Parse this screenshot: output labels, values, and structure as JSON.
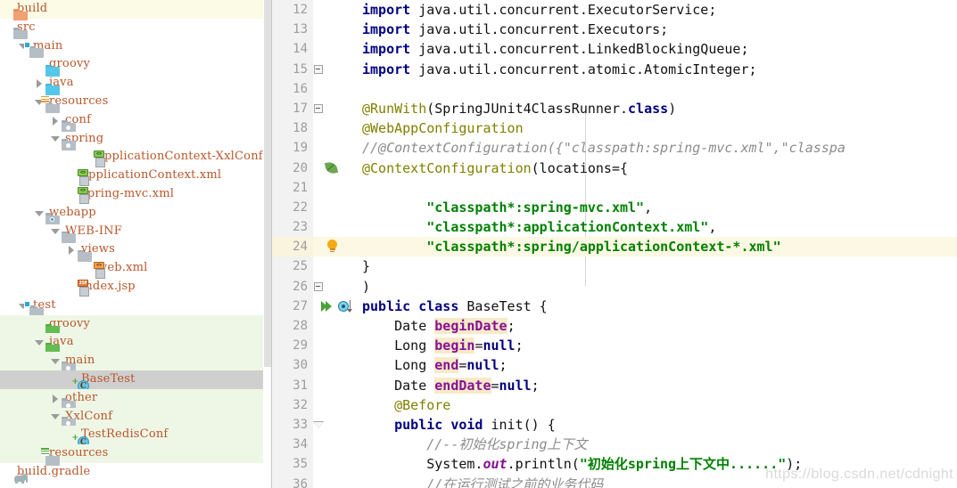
{
  "project_tree": {
    "scrollbar": {
      "name": "vertical-scrollbar"
    },
    "items": [
      {
        "label": "build",
        "indent": 0,
        "arrow": "none",
        "icon": "folder-orange",
        "state": "highlight-build"
      },
      {
        "label": "src",
        "indent": 0,
        "arrow": "none",
        "icon": "folder-gray",
        "state": "normal"
      },
      {
        "label": "main",
        "indent": 1,
        "arrow": "down",
        "icon": "folder-module",
        "state": "normal"
      },
      {
        "label": "groovy",
        "indent": 2,
        "arrow": "none",
        "icon": "folder-cyan",
        "state": "normal"
      },
      {
        "label": "java",
        "indent": 2,
        "arrow": "right",
        "icon": "folder-cyan",
        "state": "normal"
      },
      {
        "label": "resources",
        "indent": 2,
        "arrow": "down",
        "icon": "folder-resources",
        "state": "normal"
      },
      {
        "label": "conf",
        "indent": 3,
        "arrow": "right",
        "icon": "folder-package",
        "state": "normal"
      },
      {
        "label": "spring",
        "indent": 3,
        "arrow": "down",
        "icon": "folder-package",
        "state": "normal"
      },
      {
        "label": "applicationContext-XxlConf.:",
        "indent": 5,
        "arrow": "none",
        "icon": "file-xml-green",
        "state": "normal"
      },
      {
        "label": "applicationContext.xml",
        "indent": 4,
        "arrow": "none",
        "icon": "file-xml-green",
        "state": "normal"
      },
      {
        "label": "spring-mvc.xml",
        "indent": 4,
        "arrow": "none",
        "icon": "file-xml-green",
        "state": "normal"
      },
      {
        "label": "webapp",
        "indent": 2,
        "arrow": "down",
        "icon": "folder-webapp",
        "state": "normal"
      },
      {
        "label": "WEB-INF",
        "indent": 3,
        "arrow": "down",
        "icon": "folder-gray",
        "state": "normal"
      },
      {
        "label": "views",
        "indent": 4,
        "arrow": "right",
        "icon": "folder-gray",
        "state": "normal"
      },
      {
        "label": "web.xml",
        "indent": 5,
        "arrow": "none",
        "icon": "file-xml-orange",
        "state": "normal"
      },
      {
        "label": "index.jsp",
        "indent": 4,
        "arrow": "none",
        "icon": "file-jsp",
        "state": "normal"
      },
      {
        "label": "test",
        "indent": 1,
        "arrow": "down",
        "icon": "folder-module",
        "state": "normal"
      },
      {
        "label": "groovy",
        "indent": 2,
        "arrow": "none",
        "icon": "folder-green",
        "state": "highlight-green"
      },
      {
        "label": "java",
        "indent": 2,
        "arrow": "down",
        "icon": "folder-green",
        "state": "highlight-green"
      },
      {
        "label": "main",
        "indent": 3,
        "arrow": "down",
        "icon": "folder-package",
        "state": "highlight-green"
      },
      {
        "label": "BaseTest",
        "indent": 4,
        "arrow": "none",
        "icon": "file-class",
        "state": "selected"
      },
      {
        "label": "other",
        "indent": 3,
        "arrow": "right",
        "icon": "folder-package",
        "state": "highlight-green"
      },
      {
        "label": "XxlConf",
        "indent": 3,
        "arrow": "down",
        "icon": "folder-package",
        "state": "highlight-green"
      },
      {
        "label": "TestRedisConf",
        "indent": 4,
        "arrow": "none",
        "icon": "file-class",
        "state": "highlight-green"
      },
      {
        "label": "resources",
        "indent": 2,
        "arrow": "none",
        "icon": "folder-test-resources",
        "state": "highlight-green"
      },
      {
        "label": "build.gradle",
        "indent": 0,
        "arrow": "none",
        "icon": "file-gradle",
        "state": "normal"
      }
    ]
  },
  "editor": {
    "lines": [
      {
        "num": "12",
        "mark": "none",
        "fold": "none",
        "tokens": [
          {
            "t": "import ",
            "c": "kw"
          },
          {
            "t": "java.util.concurrent.ExecutorService;",
            "c": "plain"
          }
        ]
      },
      {
        "num": "13",
        "mark": "none",
        "fold": "none",
        "tokens": [
          {
            "t": "import ",
            "c": "kw"
          },
          {
            "t": "java.util.concurrent.Executors;",
            "c": "plain"
          }
        ]
      },
      {
        "num": "14",
        "mark": "none",
        "fold": "none",
        "tokens": [
          {
            "t": "import ",
            "c": "kw"
          },
          {
            "t": "java.util.concurrent.LinkedBlockingQueue;",
            "c": "plain"
          }
        ]
      },
      {
        "num": "15",
        "mark": "none",
        "fold": "box",
        "tokens": [
          {
            "t": "import ",
            "c": "kw"
          },
          {
            "t": "java.util.concurrent.atomic.AtomicInteger;",
            "c": "plain"
          }
        ]
      },
      {
        "num": "16",
        "mark": "none",
        "fold": "none",
        "tokens": []
      },
      {
        "num": "17",
        "mark": "none",
        "fold": "box",
        "tokens": [
          {
            "t": "@RunWith",
            "c": "ann"
          },
          {
            "t": "(SpringJUnit4ClassRunner.",
            "c": "plain"
          },
          {
            "t": "class",
            "c": "kw"
          },
          {
            "t": ")",
            "c": "plain"
          }
        ]
      },
      {
        "num": "18",
        "mark": "none",
        "fold": "rail",
        "tokens": [
          {
            "t": "@WebAppConfiguration",
            "c": "ann"
          }
        ]
      },
      {
        "num": "19",
        "mark": "none",
        "fold": "rail",
        "tokens": [
          {
            "t": "//@ContextConfiguration({\"classpath:spring-mvc.xml\",\"classpa",
            "c": "cmt"
          }
        ]
      },
      {
        "num": "20",
        "mark": "leaf",
        "fold": "rail",
        "tokens": [
          {
            "t": "@ContextConfiguration",
            "c": "ann"
          },
          {
            "t": "(locations={",
            "c": "plain"
          }
        ]
      },
      {
        "num": "21",
        "mark": "none",
        "fold": "rail",
        "tokens": []
      },
      {
        "num": "22",
        "mark": "none",
        "fold": "rail",
        "tokens": [
          {
            "t": "        \"classpath*:spring-mvc.xml\"",
            "c": "str"
          },
          {
            "t": ",",
            "c": "plain"
          }
        ]
      },
      {
        "num": "23",
        "mark": "none",
        "fold": "rail",
        "tokens": [
          {
            "t": "        \"classpath*:applicationContext.xml\"",
            "c": "str"
          },
          {
            "t": ",",
            "c": "plain"
          }
        ]
      },
      {
        "num": "24",
        "mark": "bulb",
        "fold": "rail",
        "highlight": true,
        "tokens": [
          {
            "t": "        \"classpath*:spring/applicationContext-*.xml\"",
            "c": "str"
          }
        ]
      },
      {
        "num": "25",
        "mark": "none",
        "fold": "rail",
        "tokens": [
          {
            "t": "}",
            "c": "plain"
          }
        ]
      },
      {
        "num": "26",
        "mark": "none",
        "fold": "end",
        "tokens": [
          {
            "t": ")",
            "c": "plain"
          }
        ]
      },
      {
        "num": "27",
        "mark": "run-override",
        "fold": "none",
        "tokens": [
          {
            "t": "public class ",
            "c": "kw"
          },
          {
            "t": "BaseTest {",
            "c": "plain"
          }
        ]
      },
      {
        "num": "28",
        "mark": "none",
        "fold": "none",
        "tokens": [
          {
            "t": "    Date ",
            "c": "plain"
          },
          {
            "t": "beginDate",
            "c": "fld"
          },
          {
            "t": ";",
            "c": "plain"
          }
        ]
      },
      {
        "num": "29",
        "mark": "none",
        "fold": "none",
        "tokens": [
          {
            "t": "    Long ",
            "c": "plain"
          },
          {
            "t": "begin",
            "c": "fld"
          },
          {
            "t": "=",
            "c": "plain"
          },
          {
            "t": "null",
            "c": "kw"
          },
          {
            "t": ";",
            "c": "plain"
          }
        ]
      },
      {
        "num": "30",
        "mark": "none",
        "fold": "none",
        "tokens": [
          {
            "t": "    Long ",
            "c": "plain"
          },
          {
            "t": "end",
            "c": "fld"
          },
          {
            "t": "=",
            "c": "plain"
          },
          {
            "t": "null",
            "c": "kw"
          },
          {
            "t": ";",
            "c": "plain"
          }
        ]
      },
      {
        "num": "31",
        "mark": "none",
        "fold": "none",
        "tokens": [
          {
            "t": "    Date ",
            "c": "plain"
          },
          {
            "t": "endDate",
            "c": "fld"
          },
          {
            "t": "=",
            "c": "plain"
          },
          {
            "t": "null",
            "c": "kw"
          },
          {
            "t": ";",
            "c": "plain"
          }
        ]
      },
      {
        "num": "32",
        "mark": "none",
        "fold": "none",
        "tokens": [
          {
            "t": "    ",
            "c": "plain"
          },
          {
            "t": "@Before",
            "c": "ann"
          }
        ]
      },
      {
        "num": "33",
        "mark": "none",
        "fold": "arrow",
        "tokens": [
          {
            "t": "    ",
            "c": "plain"
          },
          {
            "t": "public void ",
            "c": "kw"
          },
          {
            "t": "init() {",
            "c": "plain"
          }
        ]
      },
      {
        "num": "34",
        "mark": "none",
        "fold": "none",
        "tokens": [
          {
            "t": "        //--初始化spring上下文",
            "c": "cmt"
          }
        ]
      },
      {
        "num": "35",
        "mark": "none",
        "fold": "none",
        "tokens": [
          {
            "t": "        System.",
            "c": "plain"
          },
          {
            "t": "out",
            "c": "stat"
          },
          {
            "t": ".println(",
            "c": "plain"
          },
          {
            "t": "\"初始化spring上下文中......\"",
            "c": "str"
          },
          {
            "t": ");",
            "c": "plain"
          }
        ]
      },
      {
        "num": "36",
        "mark": "none",
        "fold": "none",
        "tokens": [
          {
            "t": "        //在运行测试之前的业务代码",
            "c": "cmt"
          }
        ]
      }
    ]
  },
  "watermark": {
    "text": "https://blog.csdn.net/cdnight"
  },
  "colors": {
    "keyword": "#000080",
    "string": "#008000",
    "annotation": "#808000",
    "comment": "#8c8c8c",
    "field": "#871094",
    "tree_text": "#b8562a",
    "selection": "#cfcfcf",
    "test_source": "#eef7e6",
    "line_highlight": "#fdf8e3"
  }
}
